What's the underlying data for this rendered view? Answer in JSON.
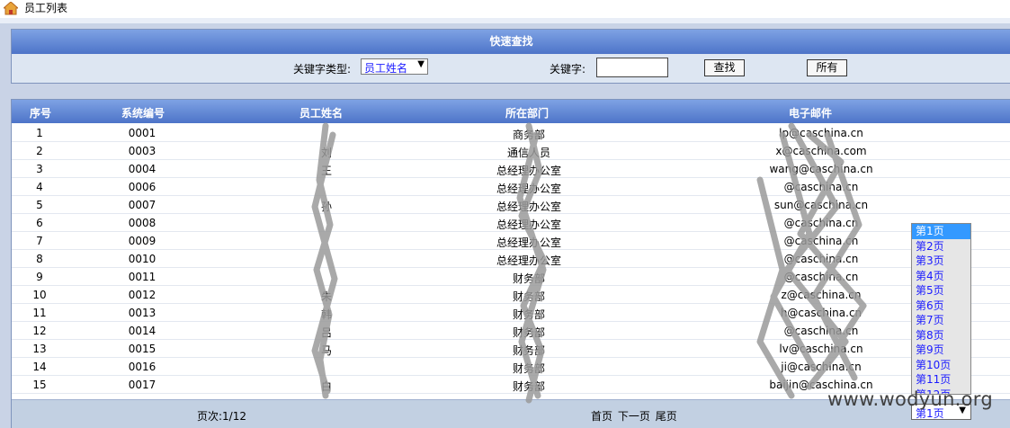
{
  "window": {
    "title": "员工列表"
  },
  "search": {
    "header": "快速查找",
    "type_label": "关键字类型:",
    "type_value": "员工姓名",
    "keyword_label": "关键字:",
    "keyword_value": "",
    "search_button": "查找",
    "all_button": "所有"
  },
  "table": {
    "headers": {
      "no": "序号",
      "code": "系统编号",
      "name": "员工姓名",
      "dept": "所在部门",
      "email": "电子邮件"
    },
    "rows": [
      {
        "no": "1",
        "code": "0001",
        "name": "",
        "dept": "商务部",
        "email": "lp@caschina.cn"
      },
      {
        "no": "2",
        "code": "0003",
        "name": "刘",
        "dept": "通信人员",
        "email": "x@caschina.com"
      },
      {
        "no": "3",
        "code": "0004",
        "name": "王",
        "dept": "总经理办公室",
        "email": "wang@caschina.cn"
      },
      {
        "no": "4",
        "code": "0006",
        "name": "",
        "dept": "总经理办公室",
        "email": "@caschina.cn"
      },
      {
        "no": "5",
        "code": "0007",
        "name": "孙",
        "dept": "总经理办公室",
        "email": "sun@caschina.cn"
      },
      {
        "no": "6",
        "code": "0008",
        "name": "",
        "dept": "总经理办公室",
        "email": "@caschina.cn"
      },
      {
        "no": "7",
        "code": "0009",
        "name": "",
        "dept": "总经理办公室",
        "email": "@caschina.cn"
      },
      {
        "no": "8",
        "code": "0010",
        "name": "",
        "dept": "总经理办公室",
        "email": "@caschina.cn"
      },
      {
        "no": "9",
        "code": "0011",
        "name": "",
        "dept": "财务部",
        "email": "@caschina.cn"
      },
      {
        "no": "10",
        "code": "0012",
        "name": "朱",
        "dept": "财务部",
        "email": "z@caschina.cn"
      },
      {
        "no": "11",
        "code": "0013",
        "name": "韩",
        "dept": "财务部",
        "email": "h@caschina.cn"
      },
      {
        "no": "12",
        "code": "0014",
        "name": "吕",
        "dept": "财务部",
        "email": "@caschina.cn"
      },
      {
        "no": "13",
        "code": "0015",
        "name": "马",
        "dept": "财务部",
        "email": "lv@caschina.cn"
      },
      {
        "no": "14",
        "code": "0016",
        "name": "",
        "dept": "财务部",
        "email": "ji@caschina.cn"
      },
      {
        "no": "15",
        "code": "0017",
        "name": "白",
        "dept": "财务部",
        "email": "baijin@caschina.cn"
      }
    ]
  },
  "pager": {
    "page_info": "页次:1/12",
    "first": "首页",
    "next": "下一页",
    "last": "尾页",
    "current": "第1页",
    "options": [
      "第1页",
      "第2页",
      "第3页",
      "第4页",
      "第5页",
      "第6页",
      "第7页",
      "第8页",
      "第9页",
      "第10页",
      "第11页",
      "第12页"
    ]
  },
  "watermark": "www.wodyun.org",
  "colors": {
    "header_blue": "#4d74c8",
    "link_blue": "#1a1aff",
    "select_highlight": "#3399ff"
  }
}
